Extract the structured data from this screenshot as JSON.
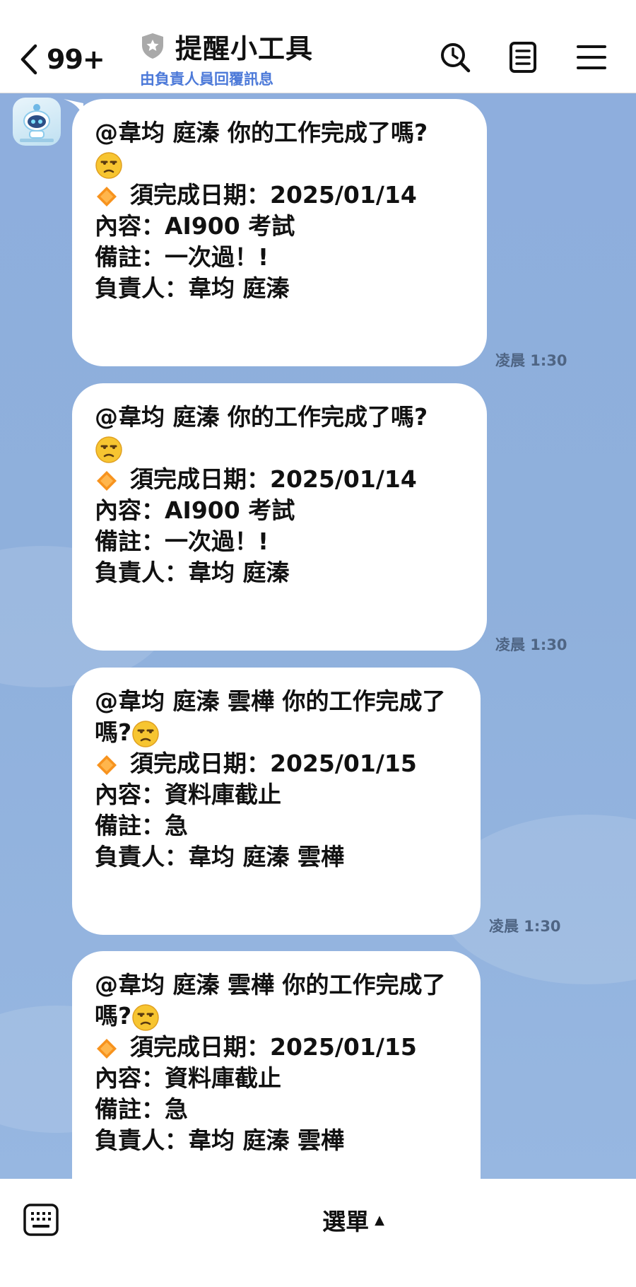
{
  "header": {
    "unread_count": "99+",
    "title": "提醒小工具",
    "subtitle": "由負責人員回覆訊息"
  },
  "icons": {
    "back": "chevron-left-icon",
    "badge": "shield-star-icon",
    "search": "search-icon",
    "notes": "notes-icon",
    "menu": "hamburger-menu-icon",
    "keyboard": "keyboard-icon",
    "caret": "caret-up-icon",
    "emoji": "unamused-face-emoji",
    "diamond": "orange-diamond-emoji"
  },
  "colors": {
    "chat_background": "#8fb0dc",
    "subtitle": "#4d7ad9",
    "bubble": "#ffffff",
    "timestamp": "#4f6584",
    "diamond": "#f7931e"
  },
  "messages": [
    {
      "mention_line": "@韋均 庭溱 你的工作完成了嗎?",
      "due_label": "須完成日期：2025/01/14",
      "content_label": "內容：AI900 考試",
      "note_label": "備註：一次過！!",
      "owner_label": "負責人：韋均 庭溱",
      "time": "凌晨 1:30"
    },
    {
      "mention_line": "@韋均 庭溱 你的工作完成了嗎?",
      "due_label": "須完成日期：2025/01/14",
      "content_label": "內容：AI900 考試",
      "note_label": "備註：一次過！!",
      "owner_label": "負責人：韋均 庭溱",
      "time": "凌晨 1:30"
    },
    {
      "mention_line": "@韋均 庭溱 雲樺 你的工作完成了嗎?",
      "due_label": "須完成日期：2025/01/15",
      "content_label": "內容：資料庫截止",
      "note_label": "備註：急",
      "owner_label": "負責人：韋均 庭溱 雲樺",
      "time": "凌晨 1:30"
    },
    {
      "mention_line": "@韋均 庭溱 雲樺 你的工作完成了嗎?",
      "due_label": "須完成日期：2025/01/15",
      "content_label": "內容：資料庫截止",
      "note_label": "備註：急",
      "owner_label": "負責人：韋均 庭溱 雲樺",
      "time": ""
    }
  ],
  "bottom_bar": {
    "menu_label": "選單"
  }
}
